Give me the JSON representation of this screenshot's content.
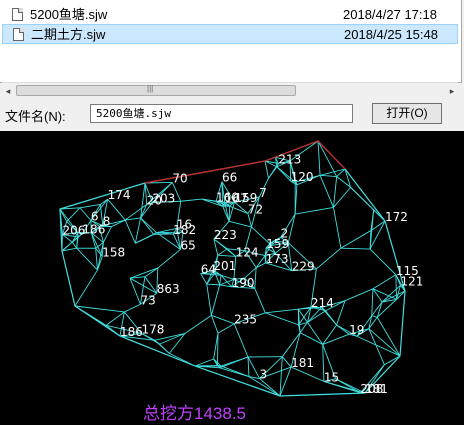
{
  "files": [
    {
      "name": "5200鱼塘.sjw",
      "date": "2018/4/27 17:18"
    },
    {
      "name": "二期土方.sjw",
      "date": "2018/4/25 15:48"
    }
  ],
  "scroll": {
    "grip": "|||",
    "left_arrow": "◂",
    "right_arrow": "▸"
  },
  "filename_label": "文件名(N):",
  "filename_value": "5200鱼塘.sjw",
  "open_button": "打开(O)",
  "total_label": "总挖方",
  "total_value": "1438.5",
  "colors": {
    "mesh": "#40e0e0",
    "boundary": "#d02020",
    "total": "#c040ff"
  },
  "mesh_labels": [
    "172",
    "181",
    "186",
    "190",
    "159",
    "159",
    "158",
    "160",
    "167",
    "174",
    "201",
    "203",
    "208",
    "182",
    "206",
    "173",
    "181",
    "186",
    "213",
    "214",
    "223",
    "229",
    "235",
    "121",
    "124",
    "120",
    "115",
    "178",
    "65",
    "64",
    "72",
    "73",
    "70",
    "863",
    "16",
    "19",
    "15",
    "20",
    "66",
    "7",
    "6",
    "3",
    "2",
    "8"
  ]
}
